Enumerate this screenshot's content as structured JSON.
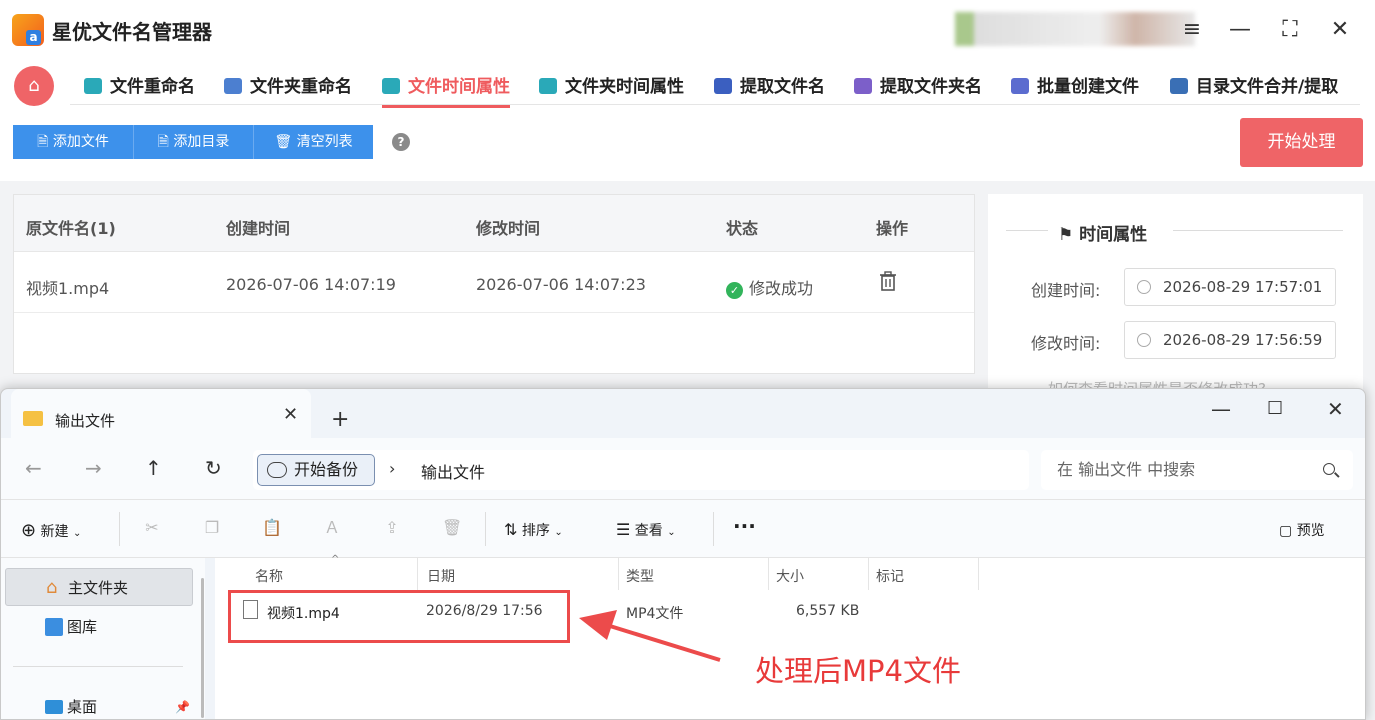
{
  "app": {
    "title": "星优文件名管理器",
    "window_controls": {
      "menu": "≡",
      "minimize": "—",
      "maximize": "⛶",
      "close": "✕"
    }
  },
  "nav": {
    "tabs": [
      {
        "label": "文件重命名",
        "icon": "rename-icon",
        "color": "#2aa9b8"
      },
      {
        "label": "文件夹重命名",
        "icon": "folder-rename-icon",
        "color": "#4c7fd0"
      },
      {
        "label": "文件时间属性",
        "icon": "file-time-icon",
        "color": "#2aa9b8",
        "active": true
      },
      {
        "label": "文件夹时间属性",
        "icon": "folder-time-icon",
        "color": "#2aa9b8"
      },
      {
        "label": "提取文件名",
        "icon": "extract-name-icon",
        "color": "#3b5fc0"
      },
      {
        "label": "提取文件夹名",
        "icon": "extract-folder-icon",
        "color": "#7c5fc9"
      },
      {
        "label": "批量创建文件",
        "icon": "batch-create-icon",
        "color": "#5b6ccf"
      },
      {
        "label": "目录文件合并/提取",
        "icon": "merge-extract-icon",
        "color": "#3a6fb5"
      }
    ]
  },
  "toolbar": {
    "add_file": "🗎 添加文件",
    "add_dir": "🗎 添加目录",
    "clear": "🗑 清空列表",
    "help": "?",
    "start": "开始处理"
  },
  "table": {
    "headers": [
      "原文件名(1)",
      "创建时间",
      "修改时间",
      "状态",
      "操作"
    ],
    "rows": [
      {
        "name": "视频1.mp4",
        "created": "2026-07-06 14:07:19",
        "modified": "2026-07-06 14:07:23",
        "status": "修改成功"
      }
    ]
  },
  "panel": {
    "title": "时间属性",
    "created_label": "创建时间:",
    "created_value": "2026-08-29 17:57:01",
    "modified_label": "修改时间:",
    "modified_value": "2026-08-29 17:56:59",
    "hint": "如何查看时间属性是否修改成功?"
  },
  "explorer": {
    "tab_title": "输出文件",
    "crumb_root": "开始备份",
    "crumb_current": "输出文件",
    "search_placeholder": "在 输出文件 中搜索",
    "commands": {
      "new": "新建",
      "sort": "排序",
      "view": "查看",
      "more": "···",
      "preview": "预览"
    },
    "sidebar": [
      {
        "label": "主文件夹",
        "icon": "home-icon"
      },
      {
        "label": "图库",
        "icon": "gallery-icon"
      },
      {
        "label": "桌面",
        "icon": "desktop-icon"
      }
    ],
    "columns": [
      "名称",
      "日期",
      "类型",
      "大小",
      "标记"
    ],
    "files": [
      {
        "name": "视频1.mp4",
        "date": "2026/8/29 17:56",
        "type": "MP4文件",
        "size": "6,557 KB"
      }
    ]
  },
  "annotation": {
    "text": "处理后MP4文件",
    "color": "#e83a3a"
  }
}
